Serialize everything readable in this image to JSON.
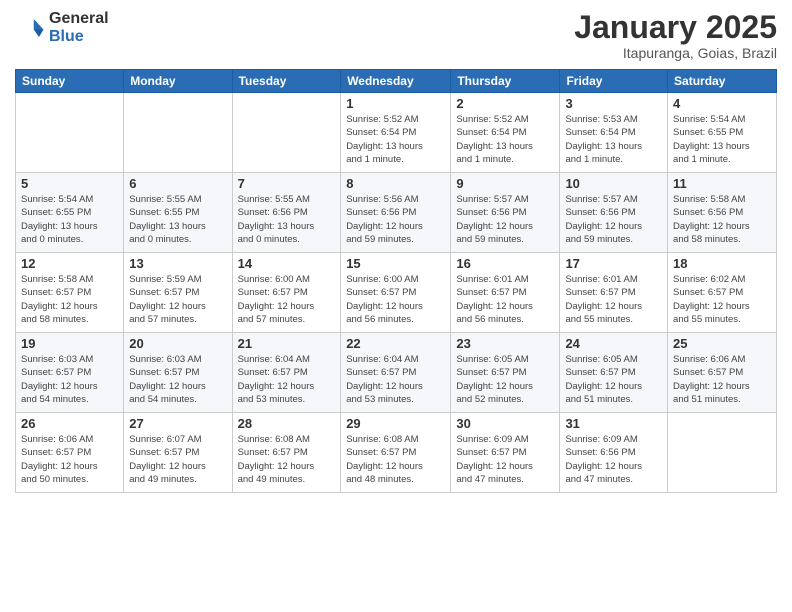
{
  "header": {
    "logo_general": "General",
    "logo_blue": "Blue",
    "month_title": "January 2025",
    "subtitle": "Itapuranga, Goias, Brazil"
  },
  "weekdays": [
    "Sunday",
    "Monday",
    "Tuesday",
    "Wednesday",
    "Thursday",
    "Friday",
    "Saturday"
  ],
  "weeks": [
    [
      {
        "day": "",
        "info": ""
      },
      {
        "day": "",
        "info": ""
      },
      {
        "day": "",
        "info": ""
      },
      {
        "day": "1",
        "info": "Sunrise: 5:52 AM\nSunset: 6:54 PM\nDaylight: 13 hours\nand 1 minute."
      },
      {
        "day": "2",
        "info": "Sunrise: 5:52 AM\nSunset: 6:54 PM\nDaylight: 13 hours\nand 1 minute."
      },
      {
        "day": "3",
        "info": "Sunrise: 5:53 AM\nSunset: 6:54 PM\nDaylight: 13 hours\nand 1 minute."
      },
      {
        "day": "4",
        "info": "Sunrise: 5:54 AM\nSunset: 6:55 PM\nDaylight: 13 hours\nand 1 minute."
      }
    ],
    [
      {
        "day": "5",
        "info": "Sunrise: 5:54 AM\nSunset: 6:55 PM\nDaylight: 13 hours\nand 0 minutes."
      },
      {
        "day": "6",
        "info": "Sunrise: 5:55 AM\nSunset: 6:55 PM\nDaylight: 13 hours\nand 0 minutes."
      },
      {
        "day": "7",
        "info": "Sunrise: 5:55 AM\nSunset: 6:56 PM\nDaylight: 13 hours\nand 0 minutes."
      },
      {
        "day": "8",
        "info": "Sunrise: 5:56 AM\nSunset: 6:56 PM\nDaylight: 12 hours\nand 59 minutes."
      },
      {
        "day": "9",
        "info": "Sunrise: 5:57 AM\nSunset: 6:56 PM\nDaylight: 12 hours\nand 59 minutes."
      },
      {
        "day": "10",
        "info": "Sunrise: 5:57 AM\nSunset: 6:56 PM\nDaylight: 12 hours\nand 59 minutes."
      },
      {
        "day": "11",
        "info": "Sunrise: 5:58 AM\nSunset: 6:56 PM\nDaylight: 12 hours\nand 58 minutes."
      }
    ],
    [
      {
        "day": "12",
        "info": "Sunrise: 5:58 AM\nSunset: 6:57 PM\nDaylight: 12 hours\nand 58 minutes."
      },
      {
        "day": "13",
        "info": "Sunrise: 5:59 AM\nSunset: 6:57 PM\nDaylight: 12 hours\nand 57 minutes."
      },
      {
        "day": "14",
        "info": "Sunrise: 6:00 AM\nSunset: 6:57 PM\nDaylight: 12 hours\nand 57 minutes."
      },
      {
        "day": "15",
        "info": "Sunrise: 6:00 AM\nSunset: 6:57 PM\nDaylight: 12 hours\nand 56 minutes."
      },
      {
        "day": "16",
        "info": "Sunrise: 6:01 AM\nSunset: 6:57 PM\nDaylight: 12 hours\nand 56 minutes."
      },
      {
        "day": "17",
        "info": "Sunrise: 6:01 AM\nSunset: 6:57 PM\nDaylight: 12 hours\nand 55 minutes."
      },
      {
        "day": "18",
        "info": "Sunrise: 6:02 AM\nSunset: 6:57 PM\nDaylight: 12 hours\nand 55 minutes."
      }
    ],
    [
      {
        "day": "19",
        "info": "Sunrise: 6:03 AM\nSunset: 6:57 PM\nDaylight: 12 hours\nand 54 minutes."
      },
      {
        "day": "20",
        "info": "Sunrise: 6:03 AM\nSunset: 6:57 PM\nDaylight: 12 hours\nand 54 minutes."
      },
      {
        "day": "21",
        "info": "Sunrise: 6:04 AM\nSunset: 6:57 PM\nDaylight: 12 hours\nand 53 minutes."
      },
      {
        "day": "22",
        "info": "Sunrise: 6:04 AM\nSunset: 6:57 PM\nDaylight: 12 hours\nand 53 minutes."
      },
      {
        "day": "23",
        "info": "Sunrise: 6:05 AM\nSunset: 6:57 PM\nDaylight: 12 hours\nand 52 minutes."
      },
      {
        "day": "24",
        "info": "Sunrise: 6:05 AM\nSunset: 6:57 PM\nDaylight: 12 hours\nand 51 minutes."
      },
      {
        "day": "25",
        "info": "Sunrise: 6:06 AM\nSunset: 6:57 PM\nDaylight: 12 hours\nand 51 minutes."
      }
    ],
    [
      {
        "day": "26",
        "info": "Sunrise: 6:06 AM\nSunset: 6:57 PM\nDaylight: 12 hours\nand 50 minutes."
      },
      {
        "day": "27",
        "info": "Sunrise: 6:07 AM\nSunset: 6:57 PM\nDaylight: 12 hours\nand 49 minutes."
      },
      {
        "day": "28",
        "info": "Sunrise: 6:08 AM\nSunset: 6:57 PM\nDaylight: 12 hours\nand 49 minutes."
      },
      {
        "day": "29",
        "info": "Sunrise: 6:08 AM\nSunset: 6:57 PM\nDaylight: 12 hours\nand 48 minutes."
      },
      {
        "day": "30",
        "info": "Sunrise: 6:09 AM\nSunset: 6:57 PM\nDaylight: 12 hours\nand 47 minutes."
      },
      {
        "day": "31",
        "info": "Sunrise: 6:09 AM\nSunset: 6:56 PM\nDaylight: 12 hours\nand 47 minutes."
      },
      {
        "day": "",
        "info": ""
      }
    ]
  ]
}
